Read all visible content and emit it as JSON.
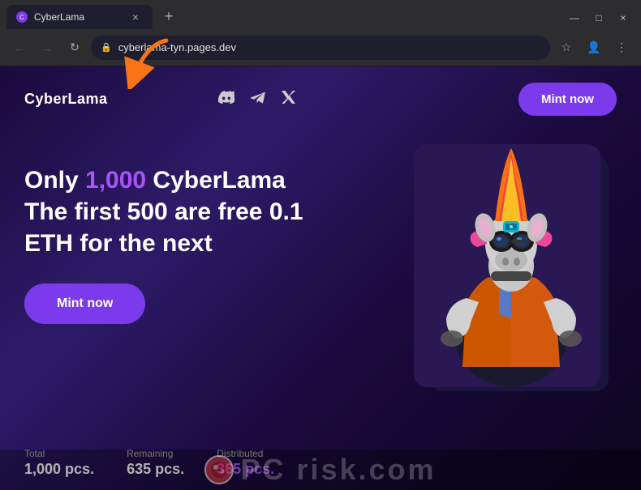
{
  "browser": {
    "tab": {
      "favicon_label": "C",
      "title": "CyberLama",
      "close_label": "×",
      "new_tab_label": "+"
    },
    "window_controls": {
      "minimize": "—",
      "maximize": "□",
      "close": "×"
    },
    "toolbar": {
      "back_arrow": "←",
      "forward_arrow": "→",
      "reload": "↻",
      "address": "cyberlama-tyn.pages.dev",
      "star": "☆",
      "profile": "👤",
      "menu": "⋮"
    }
  },
  "site": {
    "logo": "CyberLama",
    "nav_icons": {
      "discord": "🎮",
      "telegram": "✈",
      "twitter": "🐦"
    },
    "mint_button_nav": "Mint now",
    "mint_button_hero": "Mint now",
    "heading_line1_prefix": "Only ",
    "heading_highlight": "1,000",
    "heading_line1_suffix": " CyberLama",
    "heading_line2": "The first 500 are free 0.1",
    "heading_line3": "ETH for the next",
    "stats": [
      {
        "label": "Total",
        "value": "1,000 pcs.",
        "highlight": false
      },
      {
        "label": "Remaining",
        "value": "635 pcs.",
        "highlight": false
      },
      {
        "label": "Distributed",
        "value": "365 pcs.",
        "highlight": true
      }
    ]
  },
  "watermark": {
    "text": "risk.com",
    "prefix": "P",
    "dot_label": "●"
  },
  "colors": {
    "accent_purple": "#7c3aed",
    "highlight_purple": "#a855f7",
    "bg_dark": "#1a0a3d",
    "orange_arrow": "#f97316"
  }
}
